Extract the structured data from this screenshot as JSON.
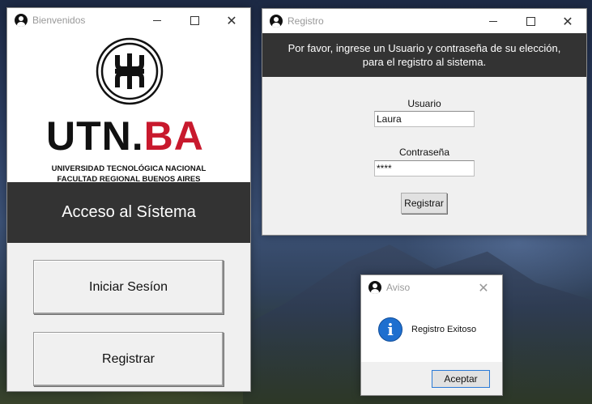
{
  "windows": {
    "bienvenidos": {
      "title": "Bienvenidos",
      "logo": {
        "word_left": "UTN.",
        "word_right": "BA",
        "line1": "UNIVERSIDAD TECNOLÓGICA NACIONAL",
        "line2": "FACULTAD REGIONAL BUENOS AIRES"
      },
      "banner": "Acceso al Sístema",
      "buttons": {
        "login": "Iniciar Sesíon",
        "register": "Registrar"
      }
    },
    "registro": {
      "title": "Registro",
      "banner_line1": "Por favor, ingrese un Usuario y contraseña de su elección,",
      "banner_line2": "para el registro al sistema.",
      "user_label": "Usuario",
      "user_value": "Laura",
      "password_label": "Contraseña",
      "password_value": "****",
      "submit": "Registrar"
    },
    "aviso": {
      "title": "Aviso",
      "message": "Registro Exitoso",
      "accept": "Aceptar",
      "icon": "info-icon"
    }
  },
  "colors": {
    "banner_bg": "#333333",
    "brand_red": "#c8192d",
    "info_blue": "#1e6fcf"
  }
}
